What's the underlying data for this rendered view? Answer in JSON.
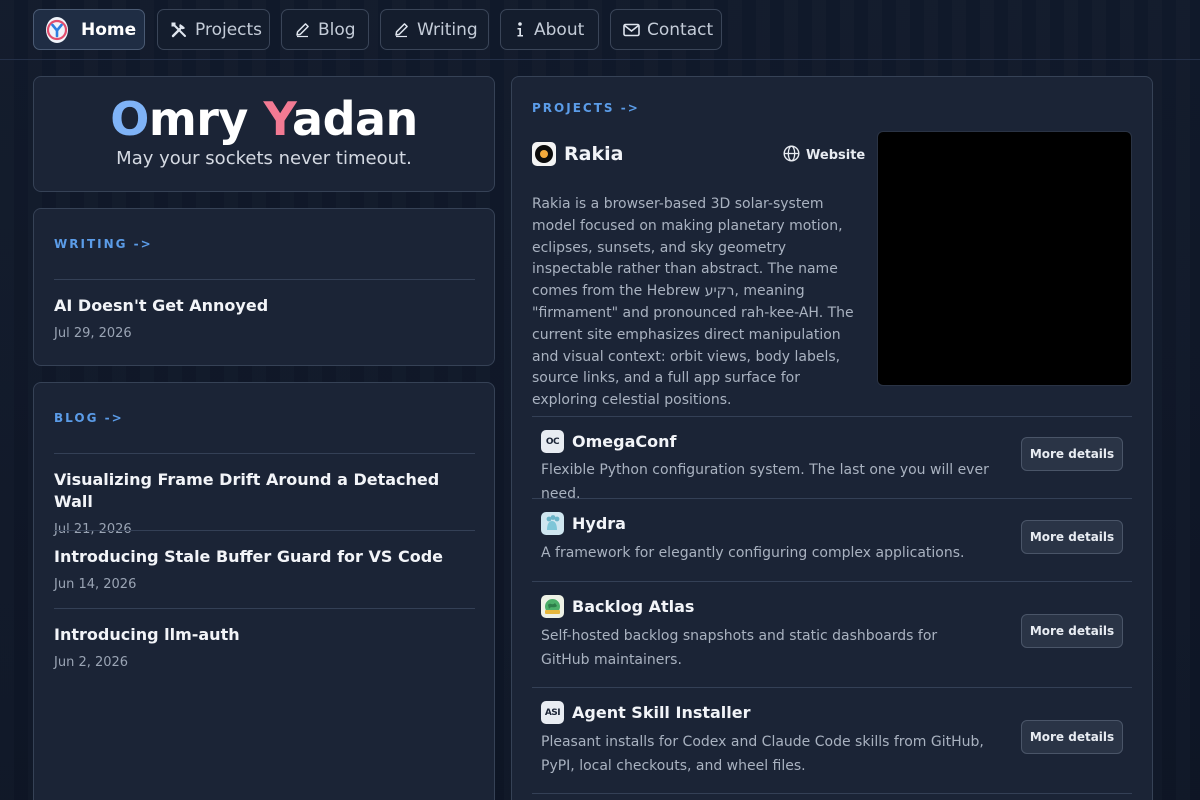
{
  "nav": {
    "items": [
      {
        "label": "Home",
        "icon": "logo-icon",
        "active": true
      },
      {
        "label": "Projects",
        "icon": "tools-icon"
      },
      {
        "label": "Blog",
        "icon": "pencil-icon"
      },
      {
        "label": "Writing",
        "icon": "pencil-icon"
      },
      {
        "label": "About",
        "icon": "info-icon"
      },
      {
        "label": "Contact",
        "icon": "mail-icon"
      }
    ]
  },
  "hero": {
    "name_first_initial": "O",
    "name_first_rest": "mry ",
    "name_last_initial": "Y",
    "name_last_rest": "adan",
    "tagline": "May your sockets never timeout."
  },
  "writing": {
    "label": "WRITING ->",
    "posts": [
      {
        "title": "AI Doesn't Get Annoyed",
        "date": "Jul 29, 2026"
      }
    ]
  },
  "blog": {
    "label": "BLOG ->",
    "posts": [
      {
        "title": "Visualizing Frame Drift Around a Detached Wall",
        "date": "Jul 21, 2026"
      },
      {
        "title": "Introducing Stale Buffer Guard for VS Code",
        "date": "Jun 14, 2026"
      },
      {
        "title": "Introducing llm-auth",
        "date": "Jun 2, 2026"
      }
    ]
  },
  "projects": {
    "label": "PROJECTS ->",
    "featured": {
      "name": "Rakia",
      "website_label": "Website",
      "description": "Rakia is a browser-based 3D solar-system model focused on making planetary motion, eclipses, sunsets, and sky geometry inspectable rather than abstract. The name comes from the Hebrew רקיע, meaning \"firmament\" and pronounced rah-kee-AH. The current site emphasizes direct manipulation and visual context: orbit views, body labels, source links, and a full app surface for exploring celestial positions."
    },
    "more_label": "More details",
    "items": [
      {
        "name": "OmegaConf",
        "icon_text": "OC",
        "description": "Flexible Python configuration system. The last one you will ever need."
      },
      {
        "name": "Hydra",
        "icon_text": "",
        "description": "A framework for elegantly configuring complex applications."
      },
      {
        "name": "Backlog Atlas",
        "icon_text": "",
        "description": "Self-hosted backlog snapshots and static dashboards for GitHub maintainers."
      },
      {
        "name": "Agent Skill Installer",
        "icon_text": "ASI",
        "description": "Pleasant installs for Codex and Claude Code skills from GitHub, PyPI, local checkouts, and wheel files."
      }
    ]
  },
  "colors": {
    "accent_blue": "#5b9ce8",
    "name_o": "#7fb3f7",
    "name_y": "#f27a93",
    "card_bg": "#1b2436"
  }
}
